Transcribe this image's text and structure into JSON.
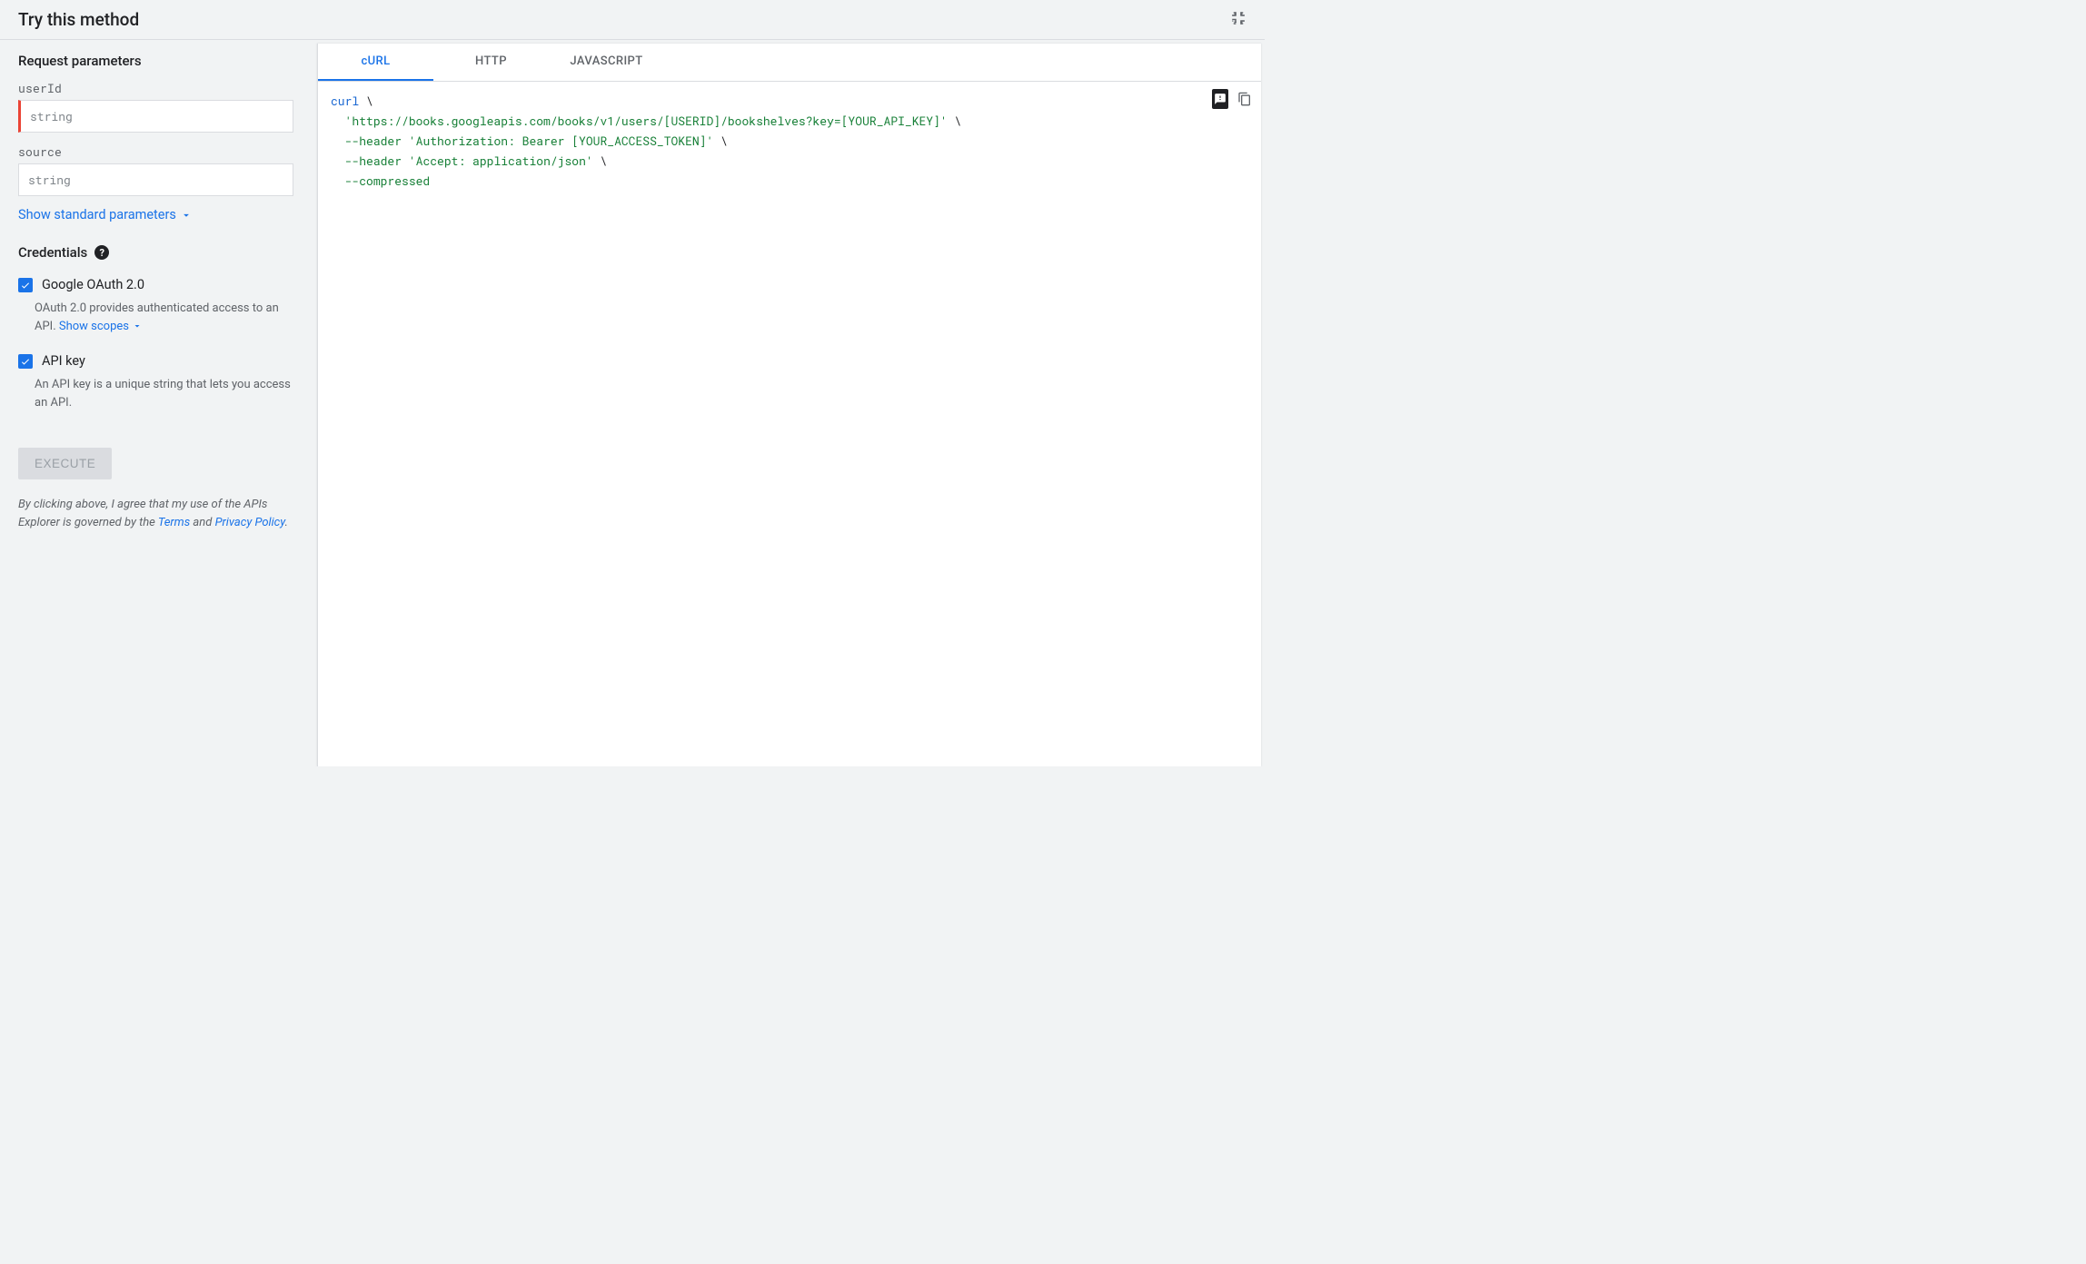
{
  "header": {
    "title": "Try this method"
  },
  "request": {
    "heading": "Request parameters",
    "params": {
      "userId": {
        "label": "userId",
        "placeholder": "string"
      },
      "source": {
        "label": "source",
        "placeholder": "string"
      }
    },
    "showStandard": "Show standard parameters"
  },
  "credentials": {
    "heading": "Credentials",
    "oauth": {
      "label": "Google OAuth 2.0",
      "desc": "OAuth 2.0 provides authenticated access to an API. ",
      "showScopes": "Show scopes"
    },
    "apikey": {
      "label": "API key",
      "desc": "An API key is a unique string that lets you access an API."
    }
  },
  "execute": {
    "label": "EXECUTE"
  },
  "disclaimer": {
    "prefix": "By clicking above, I agree that my use of the APIs Explorer is governed by the ",
    "terms": "Terms",
    "and": " and ",
    "privacy": "Privacy Policy",
    "suffix": "."
  },
  "tabs": {
    "curl": "cURL",
    "http": "HTTP",
    "js": "JAVASCRIPT"
  },
  "code": {
    "l1a": "curl",
    "l1b": " \\",
    "l2a": "  ",
    "l2b": "'https://books.googleapis.com/books/v1/users/[USERID]/bookshelves?key=[YOUR_API_KEY]'",
    "l2c": " \\",
    "l3a": "  ",
    "l3b": "--header",
    "l3c": " ",
    "l3d": "'Authorization: Bearer [YOUR_ACCESS_TOKEN]'",
    "l3e": " \\",
    "l4a": "  ",
    "l4b": "--header",
    "l4c": " ",
    "l4d": "'Accept: application/json'",
    "l4e": " \\",
    "l5a": "  ",
    "l5b": "--compressed"
  }
}
